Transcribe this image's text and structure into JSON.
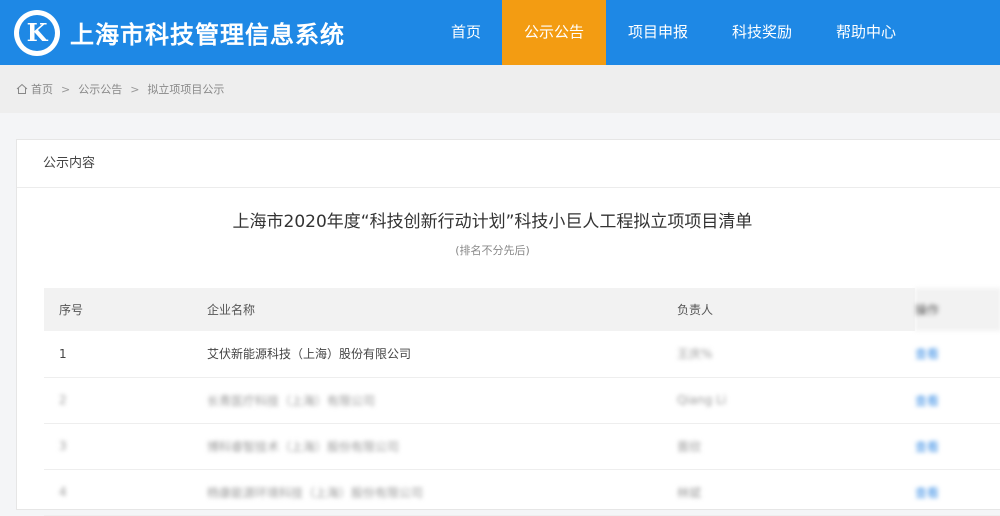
{
  "header": {
    "logo_letter": "K",
    "app_title": "上海市科技管理信息系统",
    "nav": [
      {
        "label": "首页"
      },
      {
        "label": "公示公告"
      },
      {
        "label": "项目申报"
      },
      {
        "label": "科技奖励"
      },
      {
        "label": "帮助中心"
      }
    ],
    "active_nav": "公示公告",
    "accent_color": "#f39c12",
    "brand_color": "#1e88e5"
  },
  "breadcrumb": {
    "items": [
      "首页",
      "公示公告",
      "拟立项项目公示"
    ],
    "separator": ">"
  },
  "card": {
    "header": "公示内容",
    "title": "上海市2020年度“科技创新行动计划”科技小巨人工程拟立项项目清单",
    "subtitle": "(排名不分先后)"
  },
  "table": {
    "columns": [
      "序号",
      "企业名称",
      "负责人",
      "操作"
    ],
    "rows": [
      {
        "index": "1",
        "company": "艾伏新能源科技（上海）股份有限公司",
        "leader": "王庆%",
        "action": "查看"
      },
      {
        "index": "2",
        "company": "长青医疗科技（上海）有限公司",
        "leader": "Qiang Li",
        "action": "查看"
      },
      {
        "index": "3",
        "company": "博科睿智技术（上海）股份有限公司",
        "leader": "晋欣",
        "action": "查看"
      },
      {
        "index": "4",
        "company": "杨康能源环境科技（上海）股份有限公司",
        "leader": "林斌",
        "action": "查看"
      }
    ]
  }
}
